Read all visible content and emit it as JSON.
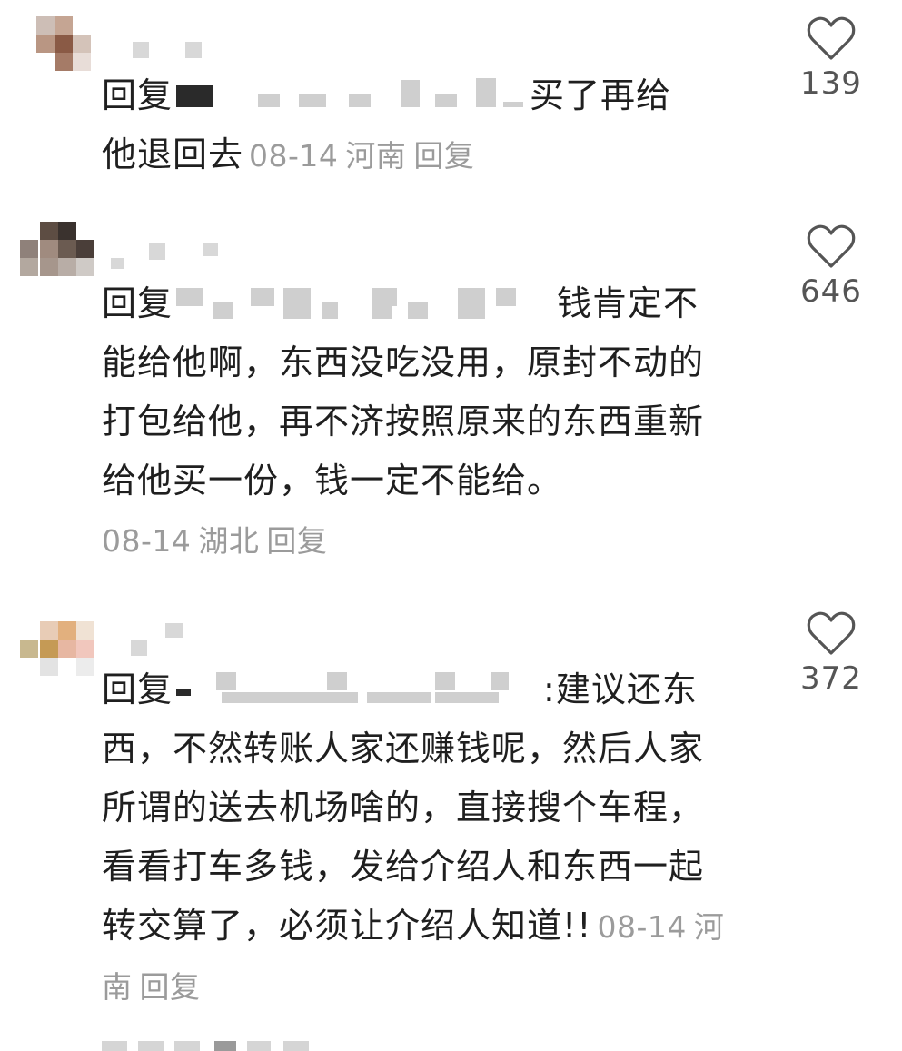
{
  "comments": [
    {
      "reply_prefix": "回复",
      "text": "买了再给他退回去",
      "text_a": "买了再给",
      "text_b": "他退回去",
      "date": "08-14",
      "location": "河南",
      "reply_label": "回复",
      "likes": "139"
    },
    {
      "reply_prefix": "回复",
      "text_a": "钱肯定不",
      "text_b": "能给他啊，东西没吃没用，原封不动的打包给他，再不济按照原来的东西重新给他买一份，钱一定不能给。",
      "date": "08-14",
      "location": "湖北",
      "reply_label": "回复",
      "likes": "646"
    },
    {
      "reply_prefix": "回复",
      "colon": ":",
      "text_a": "建议还东",
      "text_b": "西，不然转账人家还赚钱呢，然后人家所谓的送去机场啥的，直接搜个车程，看看打车多钱，发给介绍人和东西一起转交算了，必须让介绍人知道!!",
      "date": "08-14",
      "location": "河南",
      "reply_label": "回复",
      "likes": "372"
    }
  ],
  "icons": {
    "like": "heart-outline-icon"
  },
  "colors": {
    "text": "#1f1f1f",
    "meta": "#9b9b9b",
    "like_count": "#555555",
    "icon_stroke": "#555555",
    "redaction": "#cfcfcf"
  }
}
